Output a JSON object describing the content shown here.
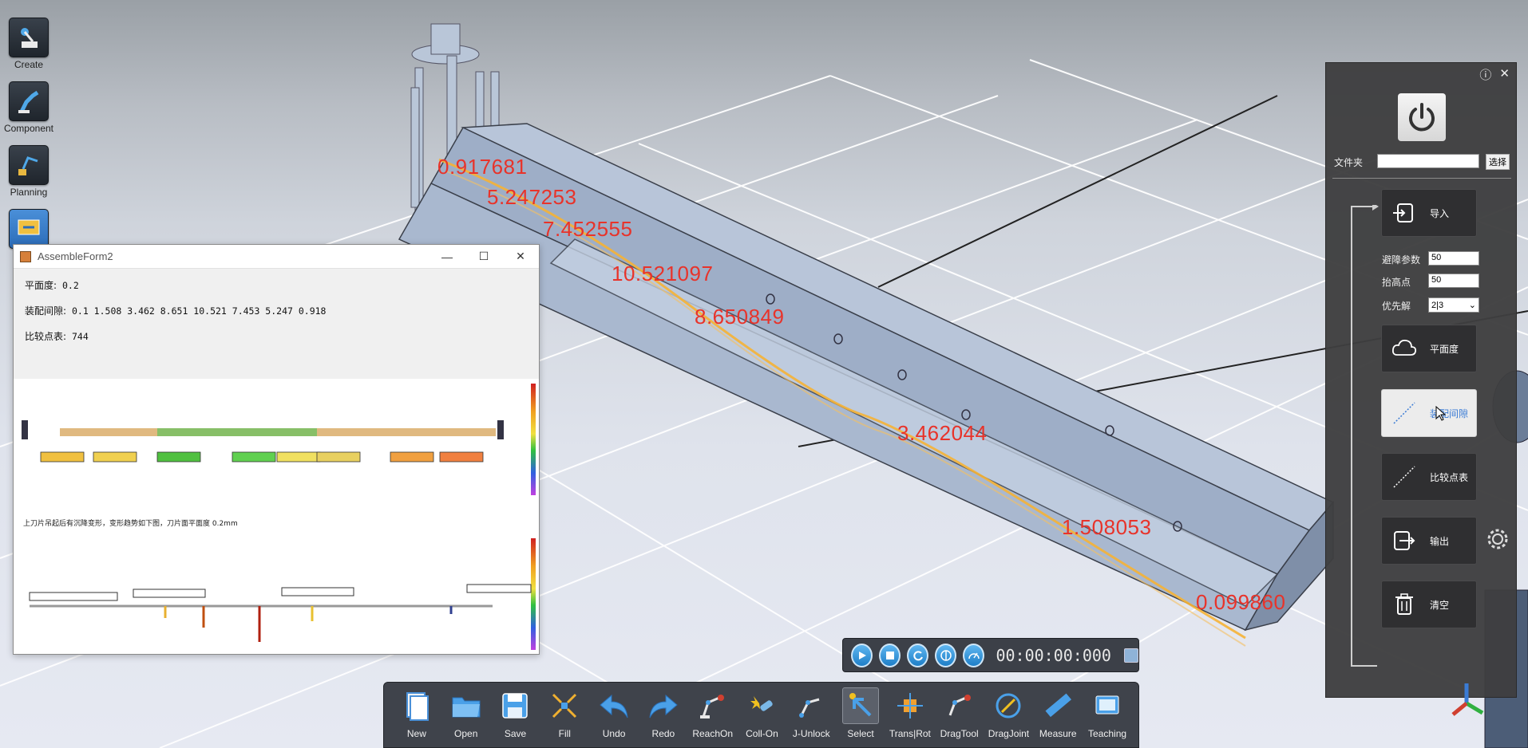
{
  "sidebar": {
    "items": [
      {
        "label": "Create",
        "icon": "robot-create-icon"
      },
      {
        "label": "Component",
        "icon": "robot-arm-icon"
      },
      {
        "label": "Planning",
        "icon": "planning-icon"
      }
    ]
  },
  "viewport": {
    "measure_labels": [
      "0.917681",
      "5.247253",
      "7.452555",
      "10.521097",
      "8.650849",
      "3.462044",
      "1.508053",
      "0.099860"
    ]
  },
  "assemble_form": {
    "title": "AssembleForm2",
    "flatness_label": "平面度:",
    "flatness_value": "0.2",
    "gap_label": "装配间隙:",
    "gap_values": "0.1 1.508 3.462 8.651 10.521 7.453 5.247 0.918",
    "points_label": "比较点表:",
    "points_value": "744",
    "plot_caption": "上刀片吊起后有沉降变形，变形趋势如下图，刀片面平面度    0.2mm"
  },
  "control_panel": {
    "folder_label": "文件夹",
    "folder_value": "",
    "pick_button": "选择",
    "import_button": "导入",
    "avoid_param_label": "避障参数",
    "avoid_param_value": "50",
    "lift_point_label": "抬高点",
    "lift_point_value": "50",
    "priority_label": "优先解",
    "priority_value": "2|3",
    "flatness_button": "平面度",
    "assembly_gap_button": "装配间隙",
    "compare_points_button": "比较点表",
    "export_button": "输出",
    "clear_button": "清空"
  },
  "sim_bar": {
    "time": "00:00:00:000"
  },
  "toolbar": {
    "items": [
      {
        "label": "New",
        "icon": "new-file-icon"
      },
      {
        "label": "Open",
        "icon": "open-folder-icon"
      },
      {
        "label": "Save",
        "icon": "save-icon"
      },
      {
        "label": "Fill",
        "icon": "fill-icon"
      },
      {
        "label": "Undo",
        "icon": "undo-icon"
      },
      {
        "label": "Redo",
        "icon": "redo-icon"
      },
      {
        "label": "ReachOn",
        "icon": "reach-icon"
      },
      {
        "label": "Coll-On",
        "icon": "collision-icon"
      },
      {
        "label": "J-Unlock",
        "icon": "joint-unlock-icon"
      },
      {
        "label": "Select",
        "icon": "select-cursor-icon"
      },
      {
        "label": "Trans|Rot",
        "icon": "transform-icon"
      },
      {
        "label": "DragTool",
        "icon": "drag-tool-icon"
      },
      {
        "label": "DragJoint",
        "icon": "drag-joint-icon"
      },
      {
        "label": "Measure",
        "icon": "ruler-icon"
      },
      {
        "label": "Teaching",
        "icon": "teaching-icon"
      }
    ]
  }
}
